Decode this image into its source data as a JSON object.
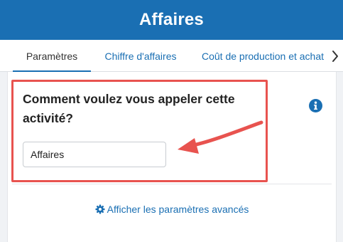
{
  "header": {
    "title": "Affaires"
  },
  "tabs": [
    {
      "label": "Paramètres",
      "active": true
    },
    {
      "label": "Chiffre d'affaires",
      "active": false
    },
    {
      "label": "Coût de production et achat",
      "active": false
    }
  ],
  "form": {
    "question": "Comment voulez vous appeler cette activité?",
    "activity_name_value": "Affaires"
  },
  "advanced_link": {
    "label": "Afficher les paramètres avancés",
    "icon": "gear-icon"
  },
  "icons": {
    "info": "info-icon",
    "next": "chevron-right-icon"
  },
  "colors": {
    "brand_blue": "#1a6fb3",
    "annotation_red": "#e8534f",
    "page_background": "#f0f2f5"
  }
}
